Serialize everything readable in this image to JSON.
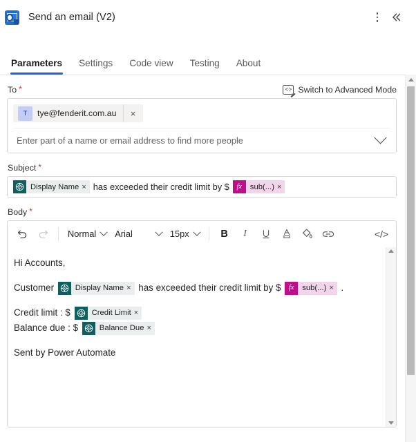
{
  "header": {
    "app_icon": "outlook-icon",
    "title": "Send an email (V2)",
    "more_menu": "more-options",
    "collapse": "«"
  },
  "tabs": [
    {
      "label": "Parameters",
      "active": true
    },
    {
      "label": "Settings",
      "active": false
    },
    {
      "label": "Code view",
      "active": false
    },
    {
      "label": "Testing",
      "active": false
    },
    {
      "label": "About",
      "active": false
    }
  ],
  "to_field": {
    "label": "To",
    "required_marker": "*",
    "advanced_mode_label": "Switch to Advanced Mode",
    "recipients": [
      {
        "initial": "T",
        "email": "tye@fenderit.com.au",
        "remove": "×"
      }
    ],
    "placeholder": "Enter part of a name or email address to find more people",
    "expand_icon": "chevron-down-icon"
  },
  "subject_field": {
    "label": "Subject",
    "required_marker": "*",
    "segments": [
      {
        "kind": "token",
        "type": "dynamic",
        "label": "Display Name",
        "remove": "×"
      },
      {
        "kind": "text",
        "text": "has exceeded their credit limit by $"
      },
      {
        "kind": "token",
        "type": "expression",
        "icon_text": "fx",
        "label": "sub(...)",
        "remove": "×"
      }
    ]
  },
  "body_field": {
    "label": "Body",
    "required_marker": "*",
    "toolbar": {
      "undo": "undo-icon",
      "redo": "redo-icon",
      "style_value": "Normal",
      "font_value": "Arial",
      "size_value": "15px",
      "bold": "B",
      "italic": "I",
      "underline": "U",
      "font_color": "A",
      "highlight_color": "highlight-icon",
      "link": "link-icon",
      "code_view": "</>"
    },
    "content": {
      "greeting": "Hi Accounts,",
      "line2_prefix": "Customer",
      "line2_token": {
        "label": "Display Name",
        "remove": "×"
      },
      "line2_middle": "has exceeded their credit limit by $",
      "line2_expression": {
        "icon_text": "fx",
        "label": "sub(...)",
        "remove": "×"
      },
      "line2_suffix": ".",
      "line3_prefix": "Credit limit : $",
      "line3_token": {
        "label": "Credit Limit",
        "remove": "×"
      },
      "line4_prefix": "Balance due : $",
      "line4_token": {
        "label": "Balance Due",
        "remove": "×"
      },
      "signature": "Sent by Power Automate"
    }
  },
  "colors": {
    "accent_blue": "#1f61d4",
    "outlook_blue": "#1f6fd0",
    "dynamic_token_icon": "#0f5e60",
    "dynamic_token_bg": "#eaeeee",
    "expression_token_icon": "#bf0d8c",
    "expression_token_bg": "#f2d5ea",
    "required_red": "#c0392b",
    "avatar_bg": "#c5cdf5"
  }
}
